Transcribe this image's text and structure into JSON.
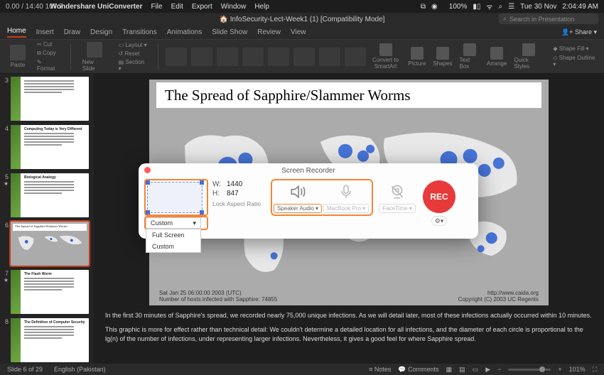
{
  "mac_menu": {
    "overlay": "0.00 / 14:40  107.7",
    "app": "Wondershare UniConverter",
    "items": [
      "File",
      "Edit",
      "Export",
      "Window",
      "Help"
    ],
    "right": {
      "battery": "100%",
      "day": "Tue 30 Nov",
      "time": "2:04:49 AM"
    }
  },
  "titlebar": {
    "doc": "InfoSecurity-Lect-Week1 (1) [Compatibility Mode]",
    "search_placeholder": "Search in Presentation"
  },
  "ribbon": {
    "tabs": [
      "Home",
      "Insert",
      "Draw",
      "Design",
      "Transitions",
      "Animations",
      "Slide Show",
      "Review",
      "View"
    ],
    "active": "Home",
    "share": "Share",
    "paste": "Paste",
    "clip": {
      "cut": "Cut",
      "copy": "Copy",
      "format": "Format"
    },
    "new_slide": "New Slide",
    "layout": {
      "layout": "Layout",
      "reset": "Reset",
      "section": "Section"
    },
    "right_items": [
      "Convert to SmartArt",
      "Picture",
      "Shapes",
      "Text Box",
      "Arrange",
      "Quick Styles"
    ],
    "shape_fill": "Shape Fill",
    "shape_outline": "Shape Outline"
  },
  "slides": {
    "list": [
      {
        "n": "3",
        "star": false,
        "title": "",
        "map": false
      },
      {
        "n": "4",
        "star": false,
        "title": "Computing Today is Very Different",
        "map": false
      },
      {
        "n": "5",
        "star": true,
        "title": "Biological Analogy",
        "map": false
      },
      {
        "n": "6",
        "star": false,
        "title": "The Spread of Sapphire/Slammer Worms",
        "map": true,
        "active": true
      },
      {
        "n": "7",
        "star": true,
        "title": "The Flash Worm",
        "map": false
      },
      {
        "n": "8",
        "star": false,
        "title": "The Definition of Computer Security",
        "map": false
      }
    ]
  },
  "current_slide": {
    "title": "The Spread of Sapphire/Slammer Worms",
    "timestamp": "Sat Jan 25 06:00:00 2003 (UTC)",
    "hosts": "Number of hosts infected with Sapphire: 74855",
    "url": "http://www.caida.org",
    "copyright": "Copyright (C) 2003 UC Regents"
  },
  "notes": {
    "p1": "In the first 30 minutes of Sapphire's spread, we recorded nearly 75,000 unique infections.  As we will detail later, most of these infections actually occurred within 10 minutes.",
    "p2": "This graphic is more for effect rather than technical detail: We couldn't determine a detailed location for all infections, and the diameter of each circle is proportional to the lg(n) of the number of infections, under representing larger infections.  Nevertheless, it gives a good feel for where Sapphire spread."
  },
  "recorder": {
    "title": "Screen Recorder",
    "mode": "Custom",
    "menu": [
      "Full Screen",
      "Custom"
    ],
    "w_label": "W:",
    "w": "1440",
    "h_label": "H:",
    "h": "847",
    "lock": "Lock Aspect Ratio",
    "speaker": "Speaker Audio",
    "mic": "MacBook Pro",
    "cam": "FaceTime",
    "rec": "REC"
  },
  "status": {
    "slide": "Slide 6 of 29",
    "lang": "English (Pakistan)",
    "notes": "Notes",
    "comments": "Comments",
    "zoom": "101%"
  }
}
